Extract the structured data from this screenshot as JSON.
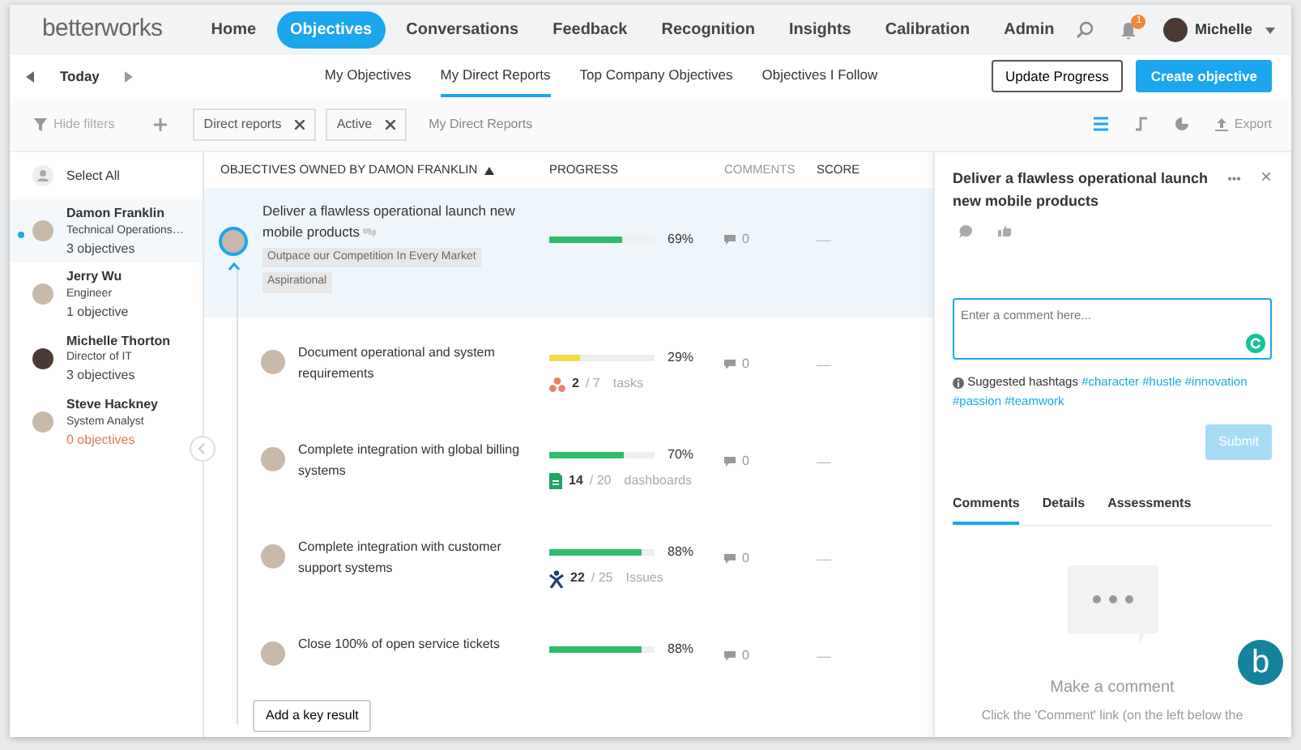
{
  "brand": "betterworks",
  "nav": [
    {
      "label": "Home",
      "selected": false
    },
    {
      "label": "Objectives",
      "selected": true
    },
    {
      "label": "Conversations",
      "selected": false
    },
    {
      "label": "Feedback",
      "selected": false
    },
    {
      "label": "Recognition",
      "selected": false
    },
    {
      "label": "Insights",
      "selected": false
    },
    {
      "label": "Calibration",
      "selected": false
    },
    {
      "label": "Admin",
      "selected": false
    }
  ],
  "notifications": "1",
  "user": {
    "name": "Michelle"
  },
  "period": "Today",
  "tabs": [
    {
      "label": "My Objectives",
      "selected": false
    },
    {
      "label": "My Direct Reports",
      "selected": true
    },
    {
      "label": "Top Company Objectives",
      "selected": false
    },
    {
      "label": "Objectives I Follow",
      "selected": false
    }
  ],
  "actions": {
    "update": "Update Progress",
    "create": "Create objective"
  },
  "filters": {
    "hide": "Hide filters",
    "chips": [
      "Direct reports",
      "Active"
    ],
    "scope": "My Direct Reports",
    "export": "Export",
    "views": [
      {
        "kind": "list",
        "selected": true
      },
      {
        "kind": "tree",
        "selected": false
      },
      {
        "kind": "chart",
        "selected": false
      }
    ]
  },
  "select_all": "Select All",
  "people": [
    {
      "name": "Damon Franklin",
      "role": "Technical Operations…",
      "count": "3 objectives",
      "selected": true,
      "alert": false,
      "dark": false
    },
    {
      "name": "Jerry Wu",
      "role": "Engineer",
      "count": "1 objective",
      "selected": false,
      "alert": false,
      "dark": false
    },
    {
      "name": "Michelle Thorton",
      "role": "Director of IT",
      "count": "3 objectives",
      "selected": false,
      "alert": false,
      "dark": true
    },
    {
      "name": "Steve Hackney",
      "role": "System Analyst",
      "count": "0 objectives",
      "selected": false,
      "alert": true,
      "dark": false
    }
  ],
  "table": {
    "columns": [
      "OBJECTIVES OWNED BY DAMON FRANKLIN",
      "PROGRESS",
      "COMMENTS",
      "SCORE"
    ],
    "objective": {
      "title": "Deliver a flawless operational launch new mobile products",
      "tags": [
        "Outpace our Competition In Every Market",
        "Aspirational"
      ],
      "level": 0.69,
      "reading": "69%",
      "color": "#2ebd6b",
      "comments": "0",
      "score": "—",
      "selected": true,
      "expanded": true
    },
    "key_results": [
      {
        "title": "Document operational and system requirements",
        "level": 0.29,
        "reading": "29%",
        "color": "#f1dc4a",
        "comments": "0",
        "score": "—",
        "source": {
          "kind": "dots",
          "done": "2",
          "total": "/ 7",
          "unit": "tasks"
        }
      },
      {
        "title": "Complete integration with global billing systems",
        "level": 0.7,
        "reading": "70%",
        "color": "#2ebd6b",
        "comments": "0",
        "score": "—",
        "source": {
          "kind": "sheet",
          "done": "14",
          "total": "/ 20",
          "unit": "dashboards"
        }
      },
      {
        "title": "Complete integration with customer support systems",
        "level": 0.88,
        "reading": "88%",
        "color": "#2ebd6b",
        "comments": "0",
        "score": "—",
        "source": {
          "kind": "figure",
          "done": "22",
          "total": "/ 25",
          "unit": "Issues"
        }
      },
      {
        "title": "Close 100% of open service tickets",
        "level": 0.88,
        "reading": "88%",
        "color": "#2ebd6b",
        "comments": "0",
        "score": "—"
      }
    ],
    "add": "Add a key result"
  },
  "panel": {
    "title": "Deliver a flawless operational launch new mobile products",
    "menu": "•••",
    "close": "×",
    "placeholder": "Enter a comment here...",
    "hashtag_label": "Suggested hashtags",
    "hashtags": [
      "#character",
      "#hustle",
      "#innovation",
      "#passion",
      "#teamwork"
    ],
    "submit": {
      "label": "Submit",
      "disabled": true
    },
    "tabs": [
      {
        "label": "Comments",
        "selected": true
      },
      {
        "label": "Details",
        "selected": false
      },
      {
        "label": "Assessments",
        "selected": false
      }
    ],
    "empty_title": "Make a comment",
    "empty_text": "Click the 'Comment' link (on the left below the"
  },
  "chat_button": "b"
}
